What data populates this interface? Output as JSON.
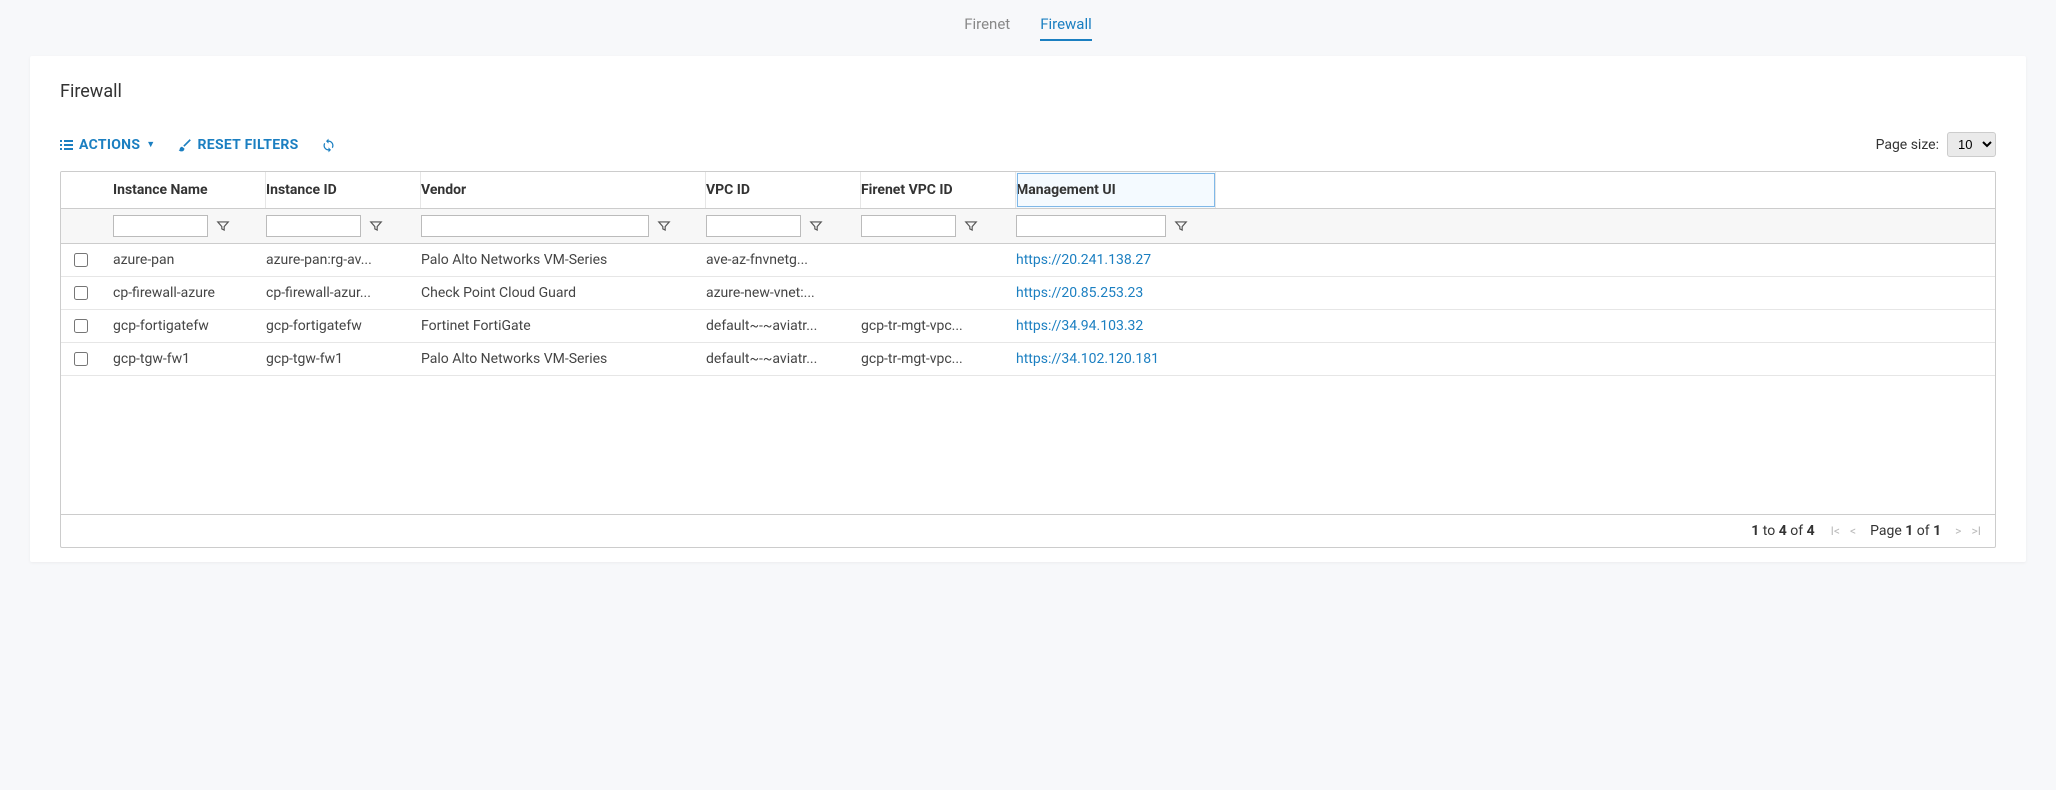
{
  "tabs": {
    "firenet": "Firenet",
    "firewall": "Firewall"
  },
  "panel": {
    "title": "Firewall"
  },
  "toolbar": {
    "actions_label": "ACTIONS",
    "reset_label": "RESET FILTERS",
    "page_size_label": "Page size:",
    "page_size_value": "10"
  },
  "columns": {
    "instance_name": "Instance Name",
    "instance_id": "Instance ID",
    "vendor": "Vendor",
    "vpc_id": "VPC ID",
    "firenet_vpc_id": "Firenet VPC ID",
    "management_ui": "Management UI"
  },
  "rows": [
    {
      "instance_name": "azure-pan",
      "instance_id": "azure-pan:rg-av...",
      "vendor": "Palo Alto Networks VM-Series",
      "vpc_id": "ave-az-fnvnetg...",
      "firenet_vpc_id": "",
      "management_ui": "https://20.241.138.27"
    },
    {
      "instance_name": "cp-firewall-azure",
      "instance_id": "cp-firewall-azur...",
      "vendor": "Check Point Cloud Guard",
      "vpc_id": "azure-new-vnet:...",
      "firenet_vpc_id": "",
      "management_ui": "https://20.85.253.23"
    },
    {
      "instance_name": "gcp-fortigatefw",
      "instance_id": "gcp-fortigatefw",
      "vendor": "Fortinet FortiGate",
      "vpc_id": "default~-~aviatr...",
      "firenet_vpc_id": "gcp-tr-mgt-vpc...",
      "management_ui": "https://34.94.103.32"
    },
    {
      "instance_name": "gcp-tgw-fw1",
      "instance_id": "gcp-tgw-fw1",
      "vendor": "Palo Alto Networks VM-Series",
      "vpc_id": "default~-~aviatr...",
      "firenet_vpc_id": "gcp-tr-mgt-vpc...",
      "management_ui": "https://34.102.120.181"
    }
  ],
  "footer": {
    "range_from": "1",
    "range_to": "4",
    "range_total": "4",
    "to_word": "to",
    "of_word": "of",
    "page_word": "Page",
    "page_current": "1",
    "page_total": "1"
  }
}
